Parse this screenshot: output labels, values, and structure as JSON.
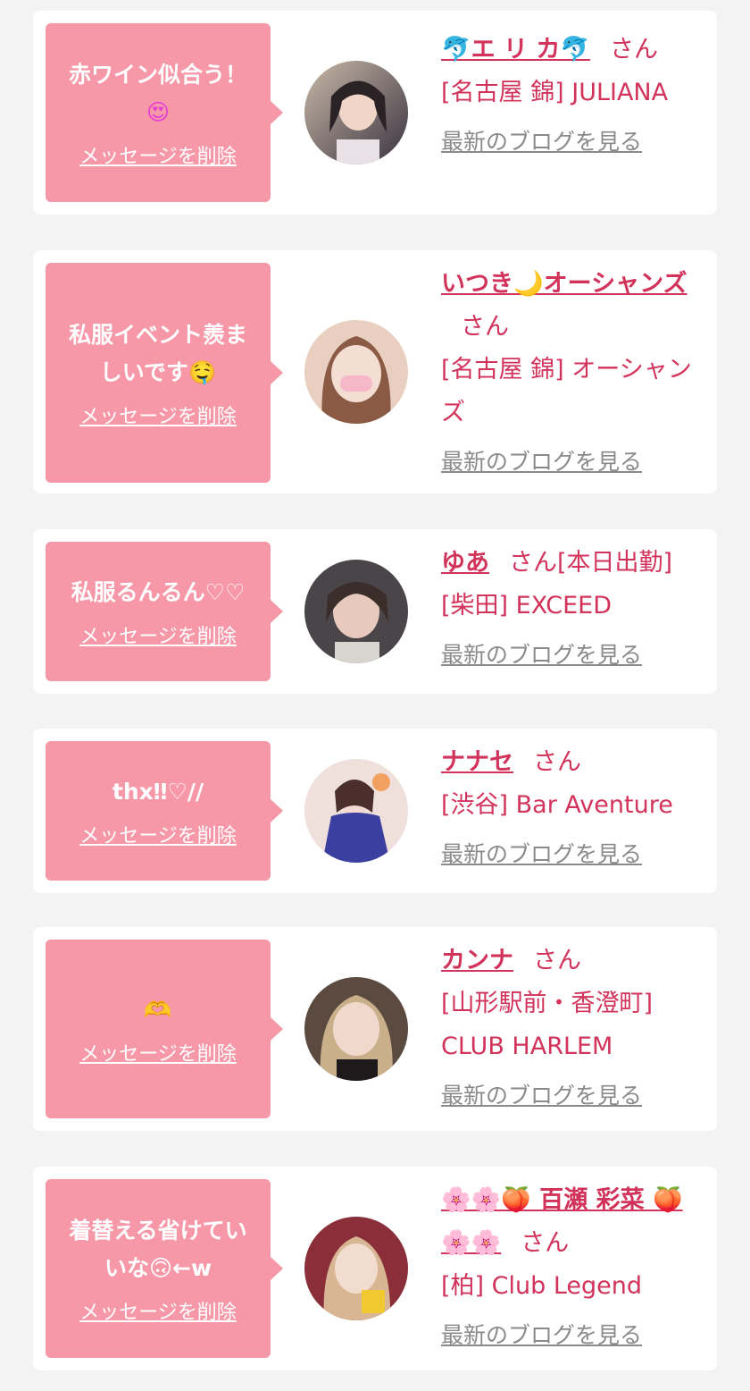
{
  "delete_label": "メッセージを削除",
  "blog_label": "最新のブログを見る",
  "honorific": "さん",
  "items": [
    {
      "message": "赤ワイン似合う！",
      "message_emoji": "😍",
      "name": "🐬エ リ カ🐬",
      "name_suffix": "",
      "location": "[名古屋 錦] JULIANA"
    },
    {
      "message": "私服イベント羨ましいです🤤",
      "message_emoji": "",
      "name": "いつき🌙オーシャンズ",
      "name_suffix": "",
      "location": "[名古屋 錦] オーシャンズ"
    },
    {
      "message": "私服るんるん♡♡",
      "message_emoji": "",
      "name": "ゆあ",
      "name_suffix": "[本日出勤]",
      "location": "[柴田] EXCEED"
    },
    {
      "message": "thx‼︎♡//",
      "message_emoji": "",
      "name": "ナナセ",
      "name_suffix": "",
      "location": "[渋谷] Bar Aventure"
    },
    {
      "message": "🫶",
      "message_emoji": "",
      "name": "カンナ",
      "name_suffix": "",
      "location": "[山形駅前・香澄町] CLUB HARLEM"
    },
    {
      "message": "着替える省けていいな🙃←w",
      "message_emoji": "",
      "name": "🌸🌸🍑 百瀬 彩菜 🍑🌸🌸",
      "name_suffix": "",
      "location": "[柏] Club Legend"
    }
  ],
  "colors": {
    "bubble": "#f698a8",
    "accent": "#d2335b",
    "muted": "#8a8a8a",
    "background": "#f3f3f3"
  },
  "icons": [
    "avatar-photo"
  ]
}
